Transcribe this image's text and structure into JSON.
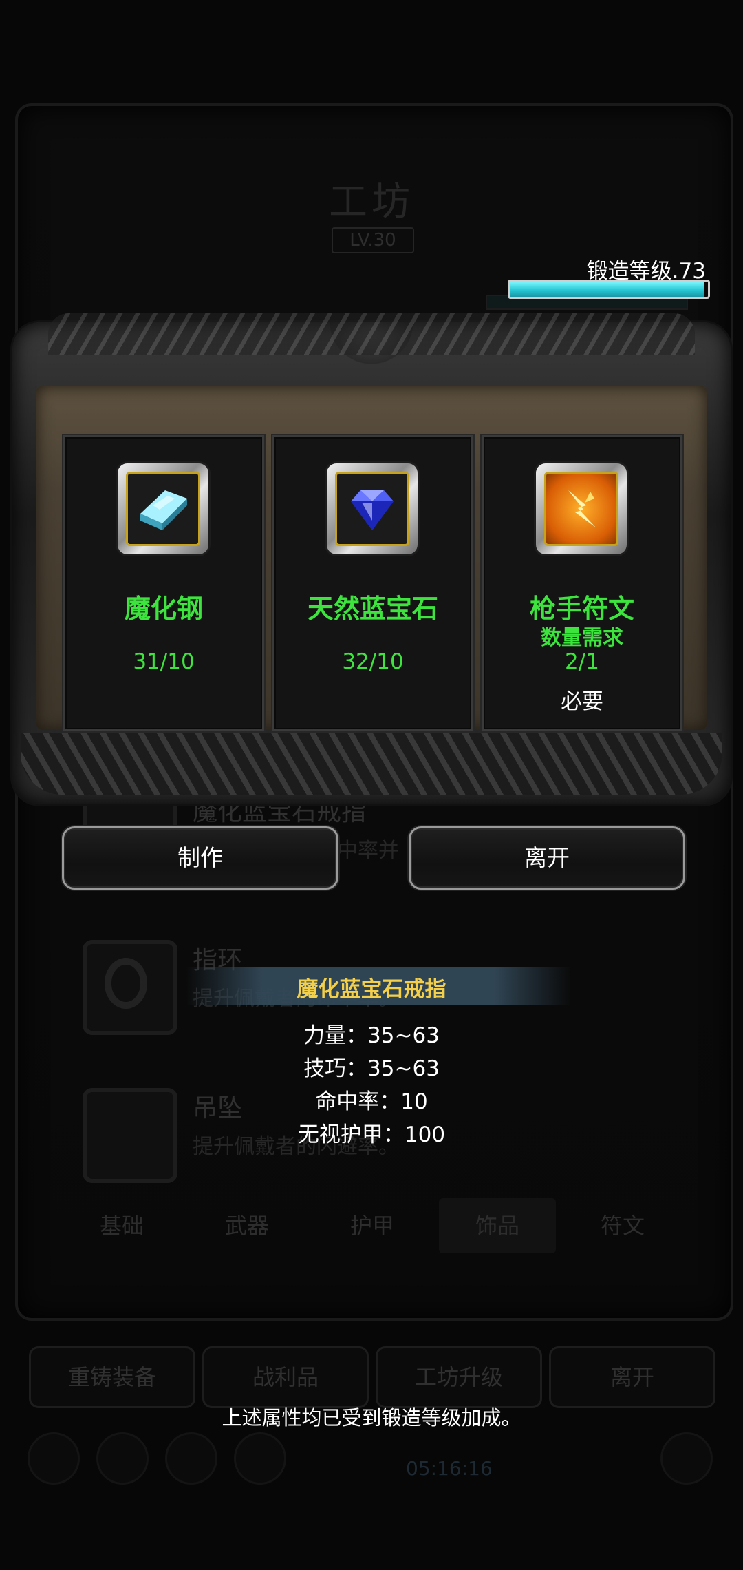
{
  "background": {
    "title": "工坊",
    "level": "LV.30",
    "list_items": [
      {
        "name": "魔化蓝宝石戒指",
        "desc": "提升佩戴者的命中率并"
      },
      {
        "name": "指环",
        "desc": "提升佩戴者的命中率。"
      },
      {
        "name": "吊坠",
        "desc": "提升佩戴者的闪避率。"
      }
    ],
    "tabs": [
      "基础",
      "武器",
      "护甲",
      "饰品",
      "符文"
    ],
    "buttons": [
      "重铸装备",
      "战利品",
      "工坊升级",
      "离开"
    ],
    "time": "05:16:16"
  },
  "forge": {
    "label": "锻造等级.73",
    "progress": 0.98
  },
  "materials": [
    {
      "name": "魔化钢",
      "sub": "",
      "count": "31/10",
      "required": "",
      "icon": "steel-ingot-icon"
    },
    {
      "name": "天然蓝宝石",
      "sub": "",
      "count": "32/10",
      "required": "",
      "icon": "sapphire-icon"
    },
    {
      "name": "枪手符文",
      "sub": "数量需求",
      "count": "2/1",
      "required": "必要",
      "icon": "rune-icon"
    }
  ],
  "actions": {
    "craft": "制作",
    "leave": "离开"
  },
  "tooltip": {
    "title": "魔化蓝宝石戒指",
    "stats": [
      "力量：35~63",
      "技巧：35~63",
      "命中率：10",
      "无视护甲：100"
    ]
  },
  "footer_note": "上述属性均已受到锻造等级加成。",
  "colors": {
    "green_text": "#3ee43e",
    "gold_text": "#f3cf4a",
    "bar_fill": "#28c8d4"
  }
}
